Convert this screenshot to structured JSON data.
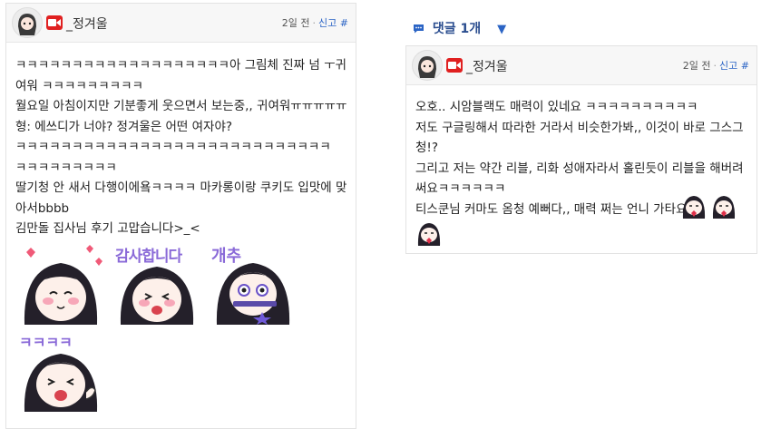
{
  "post": {
    "author": "_정겨울",
    "time": "2일 전",
    "report": "신고 #",
    "lines": [
      "ㅋㅋㅋㅋㅋㅋㅋㅋㅋㅋㅋㅋㅋㅋㅋㅋㅋㅋㅋ아 그림체 진짜 넘 ㅜ귀",
      "여워 ㅋㅋㅋㅋㅋㅋㅋㅋㅋ",
      "월요일 아침이지만 기분좋게 웃으면서 보는중,, 귀여워ㅠㅠㅠㅠㅠ",
      "형: 에쓰디가 너야? 정겨울은 어떤 여자야?",
      "ㅋㅋㅋㅋㅋㅋㅋㅋㅋㅋㅋㅋㅋㅋㅋㅋㅋㅋㅋㅋㅋㅋㅋㅋㅋㅋㅋㅋ",
      "ㅋㅋㅋㅋㅋㅋㅋㅋㅋ",
      "딸기청 안 새서 다행이에욬ㅋㅋㅋㅋ 마카롱이랑 쿠키도 입맛에 맞",
      "아서bbbb",
      "김만돌 집사님 후기 고맙습니다>_<"
    ],
    "stickers": [
      {
        "name": "heart-girl-sticker",
        "text": ""
      },
      {
        "name": "thanks-sticker",
        "text": "감사합니다"
      },
      {
        "name": "gaechu-sticker",
        "text": "개추"
      },
      {
        "name": "laugh-sticker",
        "text": "ㅋㅋㅋㅋ"
      }
    ]
  },
  "comments": {
    "header": "댓글 1개",
    "icon": "speech-bubble-icon",
    "toggle_icon": "triangle-down-icon"
  },
  "comment": {
    "author": "_정겨울",
    "time": "2일 전",
    "report": "신고 #",
    "lines": [
      "오호.. 시암블랙도 매력이 있네요 ㅋㅋㅋㅋㅋㅋㅋㅋㅋㅋ",
      "저도 구글링해서 따라한 거라서 비슷한가봐,, 이것이 바로 그스그",
      "청!?",
      "그리고 저는 약간 리블, 리화 성애자라서 홀린듯이 리블을 해버려",
      "써요ㅋㅋㅋㅋㅋㅋ",
      "티스쿤님 커마도 옴청 예뻐다,, 매력 쩌는 언니 가타요"
    ]
  },
  "colors": {
    "accent_blue": "#2b64c5",
    "badge_red": "#e02020",
    "header_bg": "#f7f7f7"
  }
}
